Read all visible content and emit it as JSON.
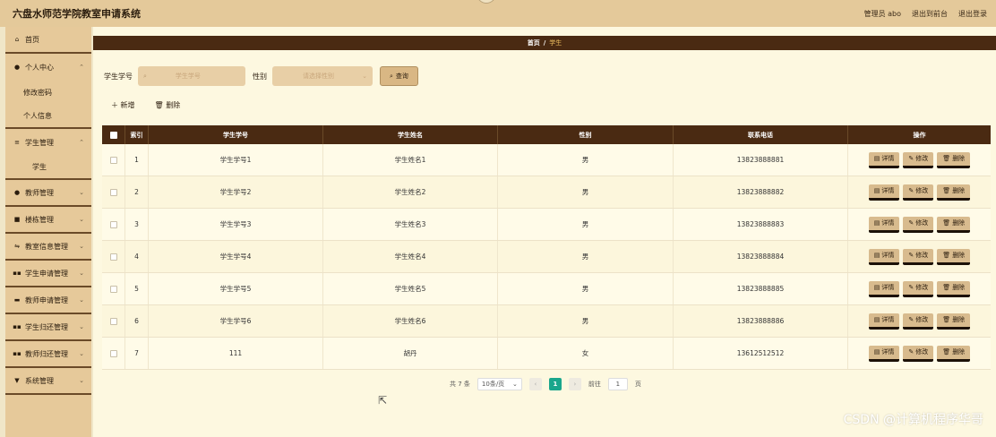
{
  "app": {
    "title": "六盘水师范学院教室申请系统"
  },
  "topbar": {
    "admin": "管理员 abo",
    "to_front": "退出到前台",
    "logout": "退出登录"
  },
  "sidebar": {
    "home": "首页",
    "personal": "个人中心",
    "change_pwd": "修改密码",
    "personal_info": "个人信息",
    "student_mgmt": "学生管理",
    "student": "学生",
    "teacher_mgmt": "教师管理",
    "building_mgmt": "楼栋管理",
    "classroom_info": "教室信息管理",
    "stu_apply": "学生申请管理",
    "tea_apply": "教师申请管理",
    "stu_return": "学生归还管理",
    "tea_return": "教师归还管理",
    "system": "系统管理"
  },
  "breadcrumb": {
    "home": "首页",
    "sep": "/",
    "current": "学生"
  },
  "search": {
    "no_label": "学生学号",
    "no_placeholder": "学生学号",
    "sex_label": "性别",
    "sex_placeholder": "请选择性别",
    "query": "查询"
  },
  "actions": {
    "add": "新增",
    "delete": "删除"
  },
  "table": {
    "headers": {
      "index": "索引",
      "no": "学生学号",
      "name": "学生姓名",
      "sex": "性别",
      "tel": "联系电话",
      "ops": "操作"
    },
    "rows": [
      {
        "idx": "1",
        "no": "学生学号1",
        "name": "学生姓名1",
        "sex": "男",
        "tel": "13823888881"
      },
      {
        "idx": "2",
        "no": "学生学号2",
        "name": "学生姓名2",
        "sex": "男",
        "tel": "13823888882"
      },
      {
        "idx": "3",
        "no": "学生学号3",
        "name": "学生姓名3",
        "sex": "男",
        "tel": "13823888883"
      },
      {
        "idx": "4",
        "no": "学生学号4",
        "name": "学生姓名4",
        "sex": "男",
        "tel": "13823888884"
      },
      {
        "idx": "5",
        "no": "学生学号5",
        "name": "学生姓名5",
        "sex": "男",
        "tel": "13823888885"
      },
      {
        "idx": "6",
        "no": "学生学号6",
        "name": "学生姓名6",
        "sex": "男",
        "tel": "13823888886"
      },
      {
        "idx": "7",
        "no": "111",
        "name": "胡丹",
        "sex": "女",
        "tel": "13612512512"
      }
    ],
    "op_detail": "详情",
    "op_edit": "修改",
    "op_delete": "删除"
  },
  "pager": {
    "total": "共 7 条",
    "size": "10条/页",
    "page": "1",
    "goto": "前往",
    "goto_value": "1",
    "page_unit": "页"
  },
  "watermark": "CSDN @计算机程序华哥",
  "colors": {
    "topbar": "#e4c99a",
    "header_dark": "#4a2a12",
    "accent_green": "#1aa68c",
    "button_tan": "#d8bb8e"
  }
}
